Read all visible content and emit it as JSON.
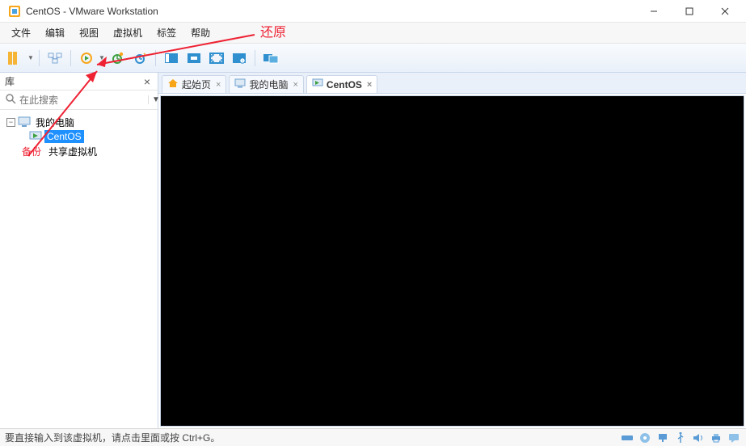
{
  "window": {
    "title": "CentOS - VMware Workstation"
  },
  "menus": [
    "文件",
    "编辑",
    "视图",
    "虚拟机",
    "标签",
    "帮助"
  ],
  "toolbar": {
    "icon_names": [
      "library-pane-icon",
      "connections-icon",
      "power-on-icon",
      "snapshot-take-icon",
      "snapshot-revert-icon",
      "snapshot-manager-icon",
      "console-icon",
      "fullscreen-guest-icon",
      "seamless-icon",
      "guest-info-icon",
      "multi-monitor-icon"
    ]
  },
  "sidebar": {
    "title": "库",
    "search_placeholder": "在此搜索",
    "tree": {
      "root": {
        "label": "我的电脑",
        "expanded": true
      },
      "child": {
        "label": "CentOS",
        "selected": true
      },
      "sibling": {
        "label": "共享虚拟机"
      }
    }
  },
  "tabs": [
    {
      "label": "起始页",
      "icon": "home-icon",
      "active": false
    },
    {
      "label": "我的电脑",
      "icon": "computer-icon",
      "active": false
    },
    {
      "label": "CentOS",
      "icon": "vm-running-icon",
      "active": true
    }
  ],
  "statusbar": {
    "message": "要直接输入到该虚拟机，请点击里面或按 Ctrl+G。"
  },
  "annotations": {
    "restore": "还原",
    "backup": "备份"
  },
  "colors": {
    "accent": "#1e90ff",
    "annot": "#e23",
    "toolbar_bg_top": "#f9fbfe",
    "toolbar_bg_bot": "#e9f0f9"
  }
}
